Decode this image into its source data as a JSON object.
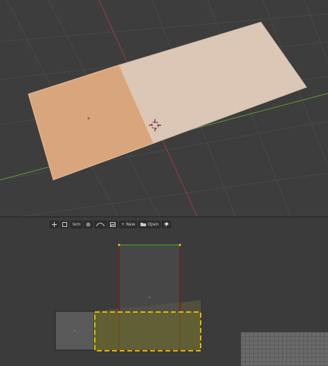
{
  "uv_toolbar": {
    "view_label": "lem",
    "new_label": "New",
    "open_label": "Open"
  },
  "colors": {
    "face_selected": "#d9a57c",
    "face_unselected": "#dcc7b6",
    "x_axis": "#9c3c46",
    "y_axis": "#6a9a3a",
    "uv_highlight": "#e8b800"
  },
  "icons": [
    "cursor-icon",
    "view-icon",
    "pivot-icon",
    "proportional-icon",
    "image-icon",
    "new-icon",
    "open-folder-icon",
    "pin-icon",
    "3d-cursor-icon"
  ]
}
